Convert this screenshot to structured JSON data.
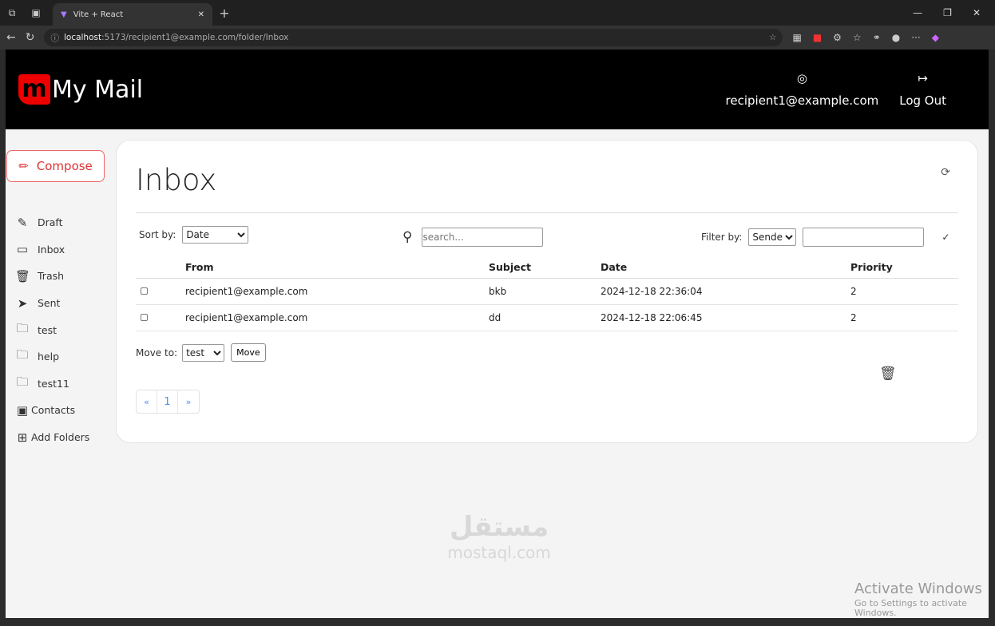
{
  "browser": {
    "tab_title": "Vite + React",
    "url_host": "localhost",
    "url_rest": ":5173/recipient1@example.com/folder/Inbox"
  },
  "header": {
    "brand": "My Mail",
    "logo_letter": "m",
    "user_email": "recipient1@example.com",
    "logout": "Log Out"
  },
  "sidebar": {
    "compose": "Compose",
    "items": [
      {
        "label": "Draft",
        "icon": "draft-icon",
        "glyph": "✎"
      },
      {
        "label": "Inbox",
        "icon": "inbox-icon",
        "glyph": "▭"
      },
      {
        "label": "Trash",
        "icon": "trash-icon",
        "glyph": "🗑"
      },
      {
        "label": "Sent",
        "icon": "send-icon",
        "glyph": "➤"
      },
      {
        "label": "test",
        "icon": "folder-icon",
        "glyph": "🗀"
      },
      {
        "label": "help",
        "icon": "folder-icon",
        "glyph": "🗀"
      },
      {
        "label": "test11",
        "icon": "folder-icon",
        "glyph": "🗀"
      },
      {
        "label": "Contacts",
        "icon": "contacts-icon",
        "glyph": "▣"
      },
      {
        "label": "Add Folders",
        "icon": "add-folder-icon",
        "glyph": "⊞"
      }
    ]
  },
  "main": {
    "title": "Inbox",
    "sort_label": "Sort by:",
    "sort_value": "Date",
    "search_placeholder": "search...",
    "filter_label": "Filter by:",
    "filter_value": "Sender",
    "filter_input": "",
    "columns": [
      "From",
      "Subject",
      "Date",
      "Priority"
    ],
    "rows": [
      {
        "from": "recipient1@example.com",
        "subject": "bkb",
        "date": "2024-12-18 22:36:04",
        "priority": "2"
      },
      {
        "from": "recipient1@example.com",
        "subject": "dd",
        "date": "2024-12-18 22:06:45",
        "priority": "2"
      }
    ],
    "move_label": "Move to:",
    "move_value": "test",
    "move_button": "Move",
    "pager": {
      "prev": "«",
      "page": "1",
      "next": "»"
    }
  },
  "overlay": {
    "watermark_ar": "مستقل",
    "watermark": "mostaql.com",
    "activate": "Activate Windows",
    "activate_sub": "Go to Settings to activate Windows."
  }
}
